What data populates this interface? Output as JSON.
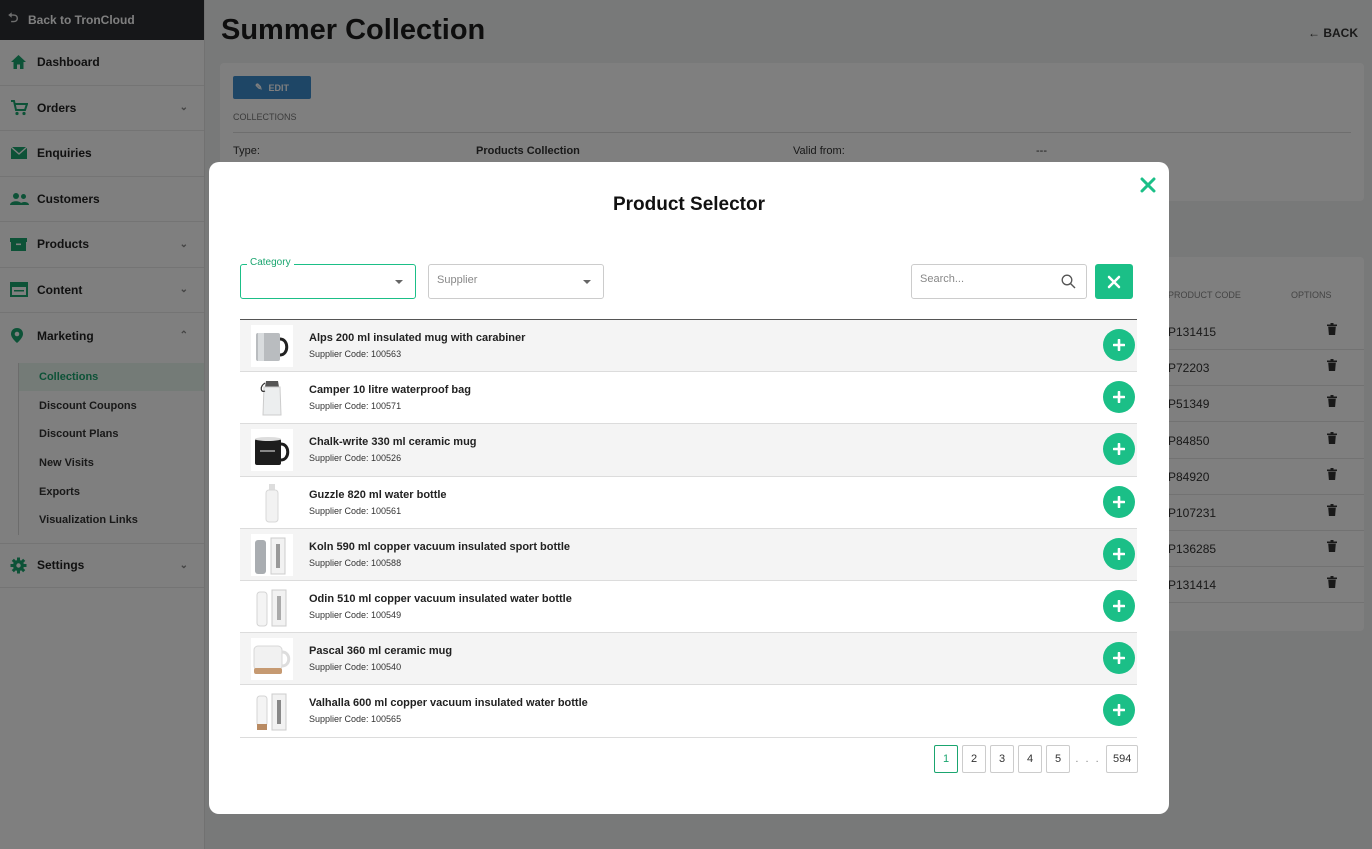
{
  "sidebar": {
    "back_label": "Back to TronCloud",
    "items": [
      {
        "label": "Dashboard",
        "icon": "home-icon",
        "has_children": false
      },
      {
        "label": "Orders",
        "icon": "cart-icon",
        "has_children": true
      },
      {
        "label": "Enquiries",
        "icon": "mail-icon",
        "has_children": false
      },
      {
        "label": "Customers",
        "icon": "users-icon",
        "has_children": false
      },
      {
        "label": "Products",
        "icon": "box-icon",
        "has_children": true
      },
      {
        "label": "Content",
        "icon": "window-icon",
        "has_children": true
      },
      {
        "label": "Marketing",
        "icon": "pin-icon",
        "has_children": true
      }
    ],
    "marketing_sub": [
      {
        "label": "Collections",
        "active": true
      },
      {
        "label": "Discount Coupons",
        "active": false
      },
      {
        "label": "Discount Plans",
        "active": false
      },
      {
        "label": "New Visits",
        "active": false
      },
      {
        "label": "Exports",
        "active": false
      },
      {
        "label": "Visualization Links",
        "active": false
      }
    ],
    "settings_label": "Settings"
  },
  "page": {
    "title": "Summer Collection",
    "back_label": "BACK",
    "edit_label": "EDIT",
    "section_label": "COLLECTIONS",
    "type_label": "Type:",
    "type_value": "Products Collection",
    "valid_from_label": "Valid from:",
    "valid_from_value": "---",
    "table_headers": {
      "code": "PRODUCT CODE",
      "options": "OPTIONS"
    },
    "product_codes": [
      "P131415",
      "P72203",
      "P51349",
      "P84850",
      "P84920",
      "P107231",
      "P136285",
      "P131414"
    ]
  },
  "modal": {
    "title": "Product Selector",
    "category_label": "Category",
    "category_value": "",
    "supplier_placeholder": "Supplier",
    "search_placeholder": "Search...",
    "products": [
      {
        "name": "Alps 200 ml insulated mug with carabiner",
        "code": "Supplier Code: 100563",
        "thumb": "steel-mug"
      },
      {
        "name": "Camper 10 litre waterproof bag",
        "code": "Supplier Code: 100571",
        "thumb": "dry-bag"
      },
      {
        "name": "Chalk-write 330 ml ceramic mug",
        "code": "Supplier Code: 100526",
        "thumb": "black-mug"
      },
      {
        "name": "Guzzle 820 ml water bottle",
        "code": "Supplier Code: 100561",
        "thumb": "white-bottle"
      },
      {
        "name": "Koln 590 ml copper vacuum insulated sport bottle",
        "code": "Supplier Code: 100588",
        "thumb": "steel-bottle-box"
      },
      {
        "name": "Odin 510 ml copper vacuum insulated water bottle",
        "code": "Supplier Code: 100549",
        "thumb": "white-bottle-box"
      },
      {
        "name": "Pascal 360 ml ceramic mug",
        "code": "Supplier Code: 100540",
        "thumb": "cork-mug"
      },
      {
        "name": "Valhalla 600 ml copper vacuum insulated water bottle",
        "code": "Supplier Code: 100565",
        "thumb": "white-bottle-box-cork"
      }
    ],
    "pagination": {
      "pages": [
        "1",
        "2",
        "3",
        "4",
        "5"
      ],
      "ellipsis": ". . .",
      "last": "594",
      "current": "1"
    }
  },
  "colors": {
    "accent": "#1bbf87",
    "accent_dark": "#1aa56f",
    "edit_button": "#3d8ccc",
    "sidebar_dark": "#2c2f33"
  }
}
